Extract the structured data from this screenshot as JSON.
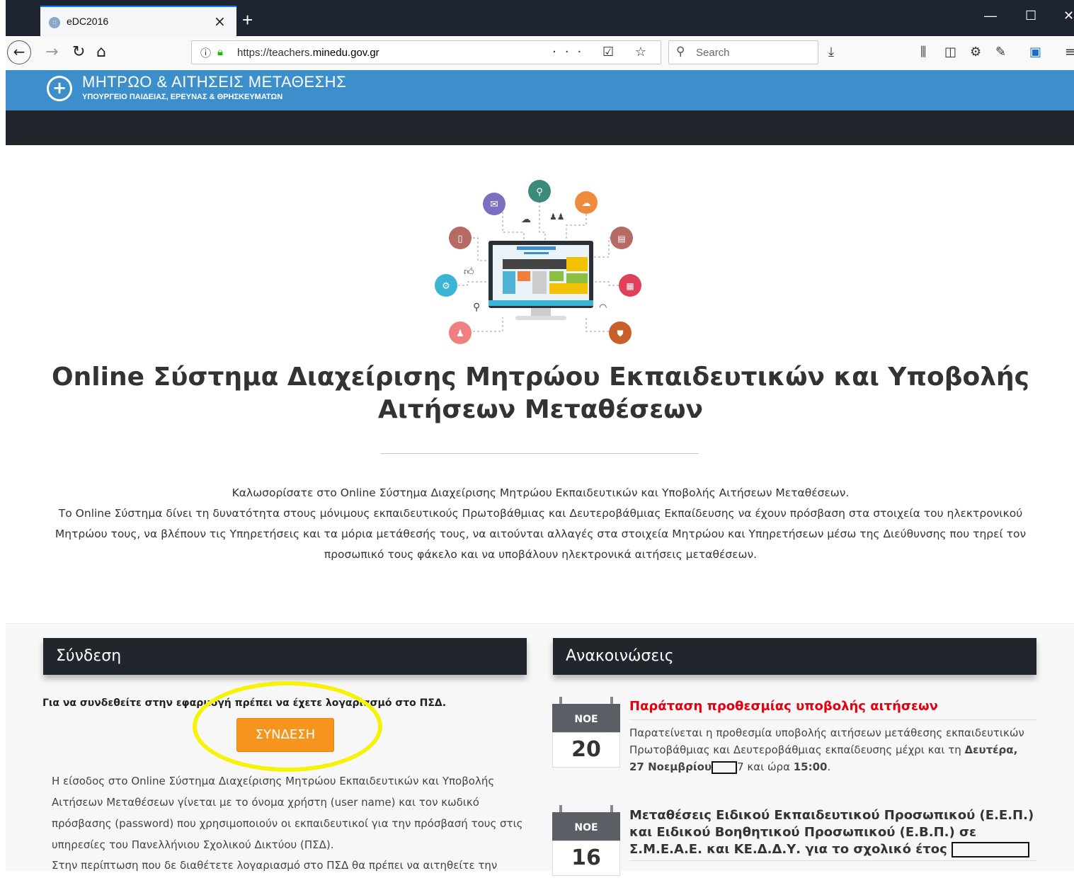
{
  "browser": {
    "tab_title": "eDC2016",
    "tab_close": "×",
    "new_tab": "+",
    "url_prefix": "https://teachers.",
    "url_domain": "minedu.gov.gr",
    "search_placeholder": "Search",
    "url_actions": "··· ☑ ☆",
    "minimize": "—",
    "maximize": "☐",
    "close": "✕"
  },
  "site": {
    "title": "ΜΗΤΡΩΟ & ΑΙΤΗΣΕΙΣ ΜΕΤΑΘΕΣΗΣ",
    "subtitle": "ΥΠΟΥΡΓΕΙΟ ΠΑΙΔΕΙΑΣ, ΕΡΕΥΝΑΣ & ΘΡΗΣΚΕΥΜΑΤΩΝ"
  },
  "hero": {
    "title": "Online Σύστημα Διαχείρισης Μητρώου Εκπαιδευτικών και Υποβολής Αιτήσεων Μεταθέσεων",
    "intro_line1": "Καλωσορίσατε στο Online Σύστημα Διαχείρισης Μητρώου Εκπαιδευτικών και Υποβολής Αιτήσεων Μεταθέσεων.",
    "intro_line2": "Το Online Σύστημα δίνει τη δυνατότητα στους μόνιμους εκπαιδευτικούς Πρωτοβάθμιας και Δευτεροβάθμιας Εκπαίδευσης να έχουν πρόσβαση στα στοιχεία του ηλεκτρονικού Μητρώου τους, να βλέπουν τις Υπηρετήσεις και τα μόρια μετάθεσής τους, να αιτούνται αλλαγές στα στοιχεία Μητρώου και Υπηρετήσεων μέσω της Διεύθυνσης που τηρεί τον προσωπικό τους φάκελο και να υποβάλουν ηλεκτρονικά αιτήσεις μεταθέσεων."
  },
  "login": {
    "heading": "Σύνδεση",
    "note": "Για να συνδεθείτε στην εφαρμογή πρέπει να έχετε λογαριασμό στο ΠΣΔ.",
    "button": "ΣΥΝΔΕΣΗ",
    "body": "Η είσοδος στο Online Σύστημα Διαχείρισης Μητρώου Εκπαιδευτικών και Υποβολής Αιτήσεων Μεταθέσεων γίνεται με το όνομα χρήστη (user name) και τον κωδικό πρόσβασης (password) που χρησιμοποιούν οι εκπαιδευτικοί για την πρόσβασή τους στις υπηρεσίες του Πανελλήνιου Σχολικού Δικτύου (ΠΣΔ).",
    "body_cut": "Στην περίπτωση που δε διαθέτετε λογαριασμό στο ΠΣΔ θα πρέπει να αιτηθείτε την"
  },
  "announcements": {
    "heading": "Ανακοινώσεις",
    "items": [
      {
        "month": "ΝΟΕ",
        "day": "20",
        "title": "Παράταση προθεσμίας υποβολής αιτήσεων",
        "body_start": "Παρατείνεται η προθεσμία υποβολής αιτήσεων μετάθεσης εκπαιδευτικών Πρωτοβάθμιας και Δευτεροβάθμιας εκπαίδευσης μέχρι και τη ",
        "body_bold": "Δευτέρα, 27 Νοεμβρίου",
        "body_mid": "7 και ώρα ",
        "body_time": "15:00",
        "body_end": ".",
        "title_color": "#e3000f"
      },
      {
        "month": "ΝΟΕ",
        "day": "16",
        "title": "Μεταθέσεις Ειδικού Εκπαιδευτικού Προσωπικού (Ε.Ε.Π.) και Ειδικού Βοηθητικού Προσωπικού (Ε.Β.Π.) σε Σ.Μ.Ε.Α.Ε. και ΚΕ.Δ.Δ.Υ. για το σχολικό έτος",
        "title_color": "#333333"
      }
    ]
  },
  "colors": {
    "header_blue": "#3d8fcc",
    "dark_bar": "#21262c",
    "accent_orange": "#f7941d",
    "highlight_yellow": "#f6f20a"
  }
}
